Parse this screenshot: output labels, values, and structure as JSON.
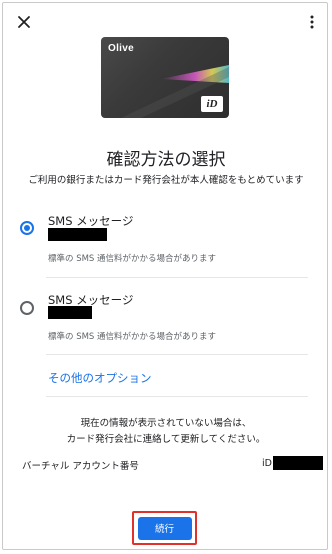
{
  "header": {
    "close_icon": "close-icon",
    "more_icon": "more-vert-icon"
  },
  "card": {
    "name": "Olive",
    "badge": "iD",
    "colors": {
      "body": "#3a3a3a",
      "stripe": [
        "#e05bd0",
        "#f0e25a",
        "#5ad0e0"
      ]
    }
  },
  "title": "確認方法の選択",
  "subtitle": "ご利用の銀行またはカード発行会社が本人確認をもとめています",
  "options": [
    {
      "label": "SMS メッセージ",
      "note": "標準の SMS 通信料がかかる場合があります",
      "selected": true
    },
    {
      "label": "SMS メッセージ",
      "note": "標準の SMS 通信料がかかる場合があります",
      "selected": false
    }
  ],
  "other_options": "その他のオプション",
  "notice": {
    "line1": "現在の情報が表示されていない場合は、",
    "line2": "カード発行会社に連絡して更新してください。"
  },
  "account": {
    "label": "バーチャル アカウント番号",
    "prefix": "iD"
  },
  "continue_label": "続行",
  "colors": {
    "accent": "#1a73e8",
    "highlight_border": "#e0312a"
  }
}
